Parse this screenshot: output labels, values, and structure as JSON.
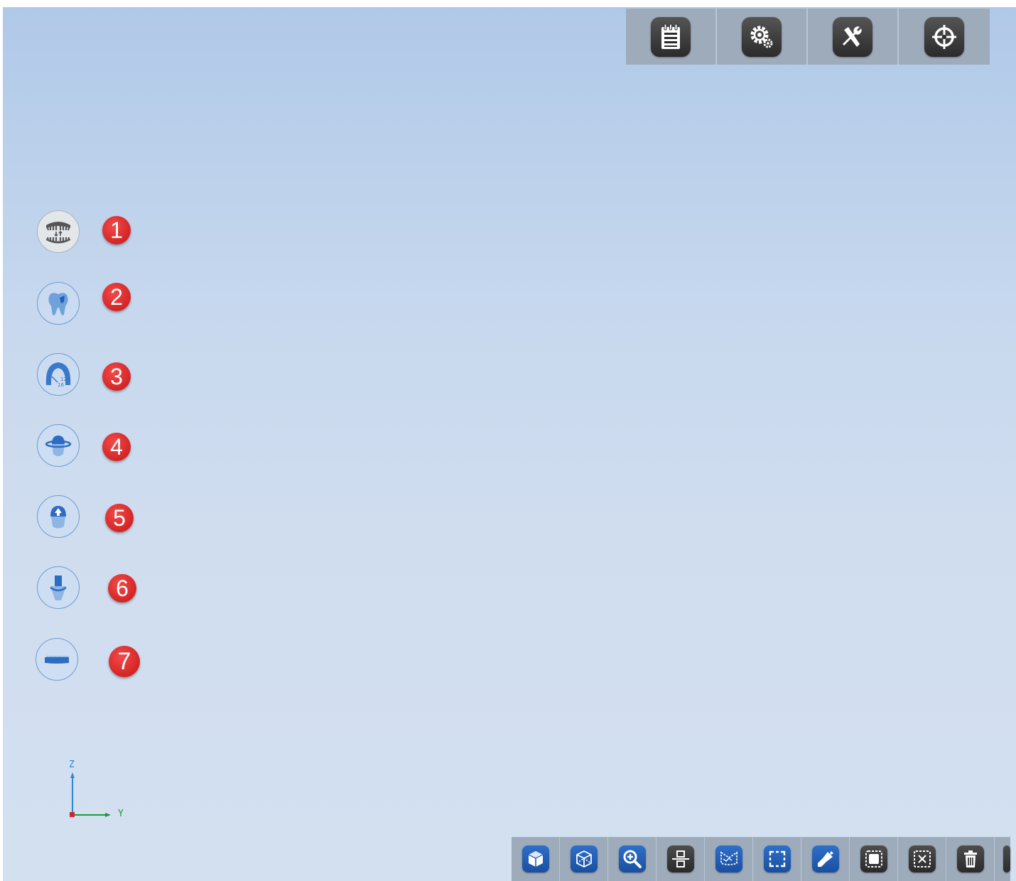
{
  "top_toolbar": {
    "buttons": [
      {
        "icon": "notepad-icon"
      },
      {
        "icon": "settings-gears-icon"
      },
      {
        "icon": "tools-icon"
      },
      {
        "icon": "crosshair-icon"
      }
    ]
  },
  "left_steps": [
    {
      "number": "1",
      "icon": "bite-jaws-icon"
    },
    {
      "number": "2",
      "icon": "tooth-marker-icon"
    },
    {
      "number": "3",
      "icon": "dental-arch-icon"
    },
    {
      "number": "4",
      "icon": "margin-line-icon"
    },
    {
      "number": "5",
      "icon": "insertion-direction-icon"
    },
    {
      "number": "6",
      "icon": "abutment-icon"
    },
    {
      "number": "7",
      "icon": "flat-base-icon"
    }
  ],
  "axis": {
    "z_label": "Z",
    "y_label": "Y"
  },
  "bottom_toolbar": {
    "buttons": [
      {
        "icon": "solid-view-icon"
      },
      {
        "icon": "wireframe-view-icon"
      },
      {
        "icon": "zoom-icon"
      },
      {
        "icon": "align-split-icon"
      },
      {
        "icon": "lasso-select-icon"
      },
      {
        "icon": "rect-select-icon"
      },
      {
        "icon": "brush-select-icon"
      },
      {
        "icon": "select-all-icon"
      },
      {
        "icon": "deselect-icon"
      },
      {
        "icon": "delete-icon"
      },
      {
        "icon": "more-icon"
      }
    ]
  },
  "colors": {
    "badge": "#d42525",
    "tool_blue": "#1a4fa0",
    "step_icon": "#3a78c9"
  }
}
